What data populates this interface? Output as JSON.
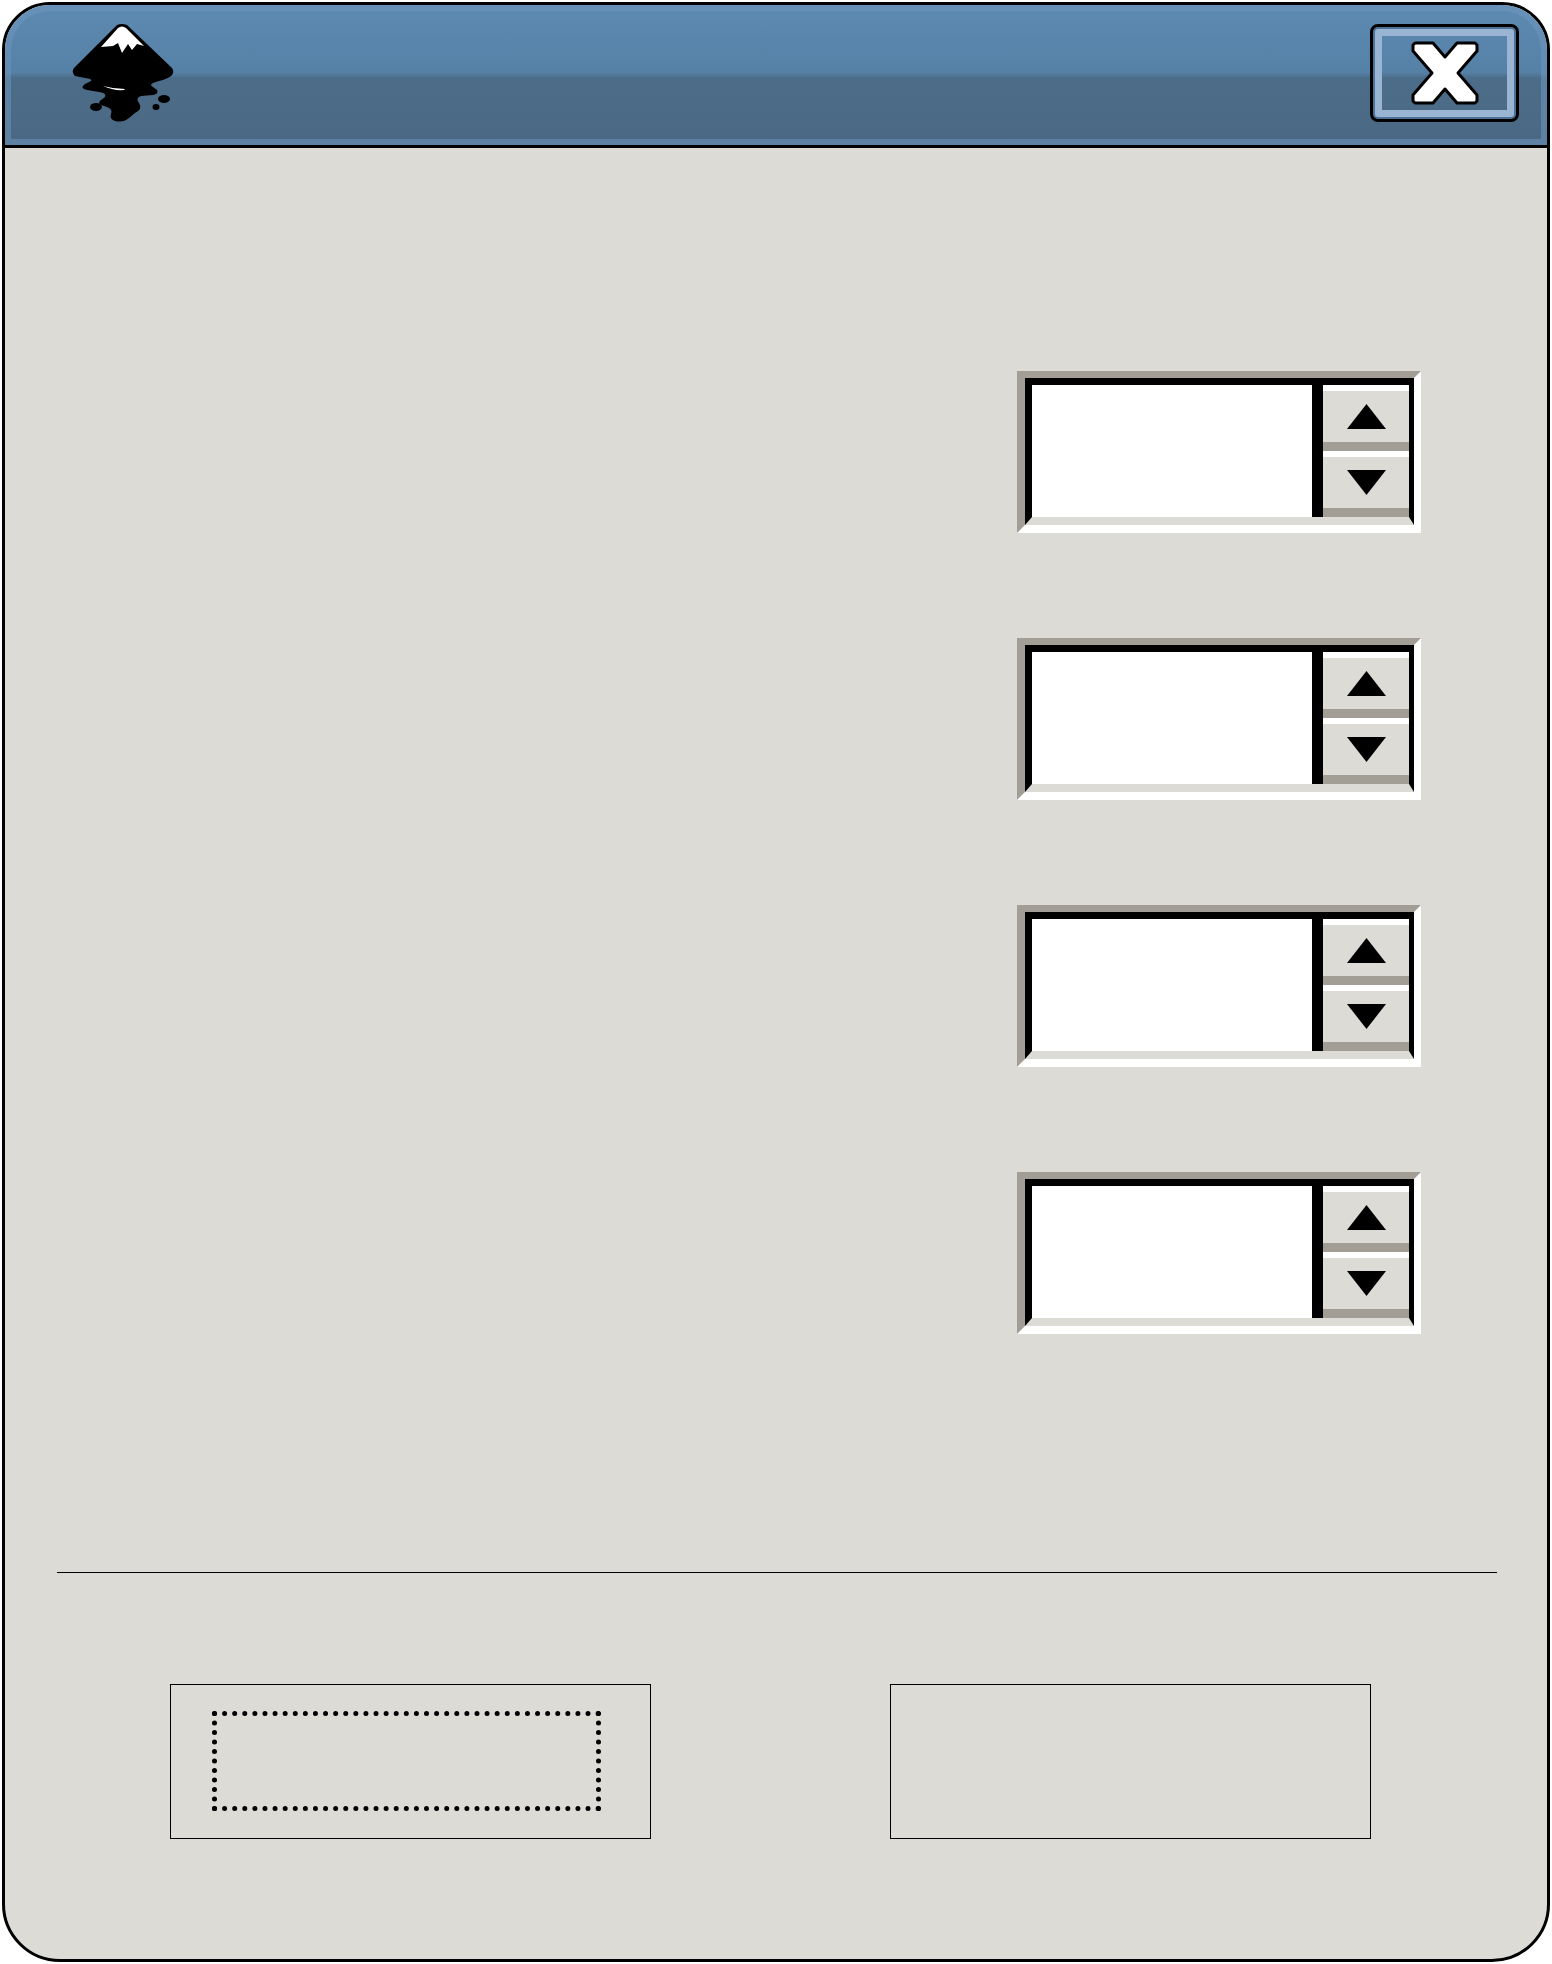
{
  "spin_fields": [
    {
      "kind": "spin"
    },
    {
      "kind": "spin"
    },
    {
      "kind": "spin"
    },
    {
      "kind": "spin"
    }
  ],
  "buttons": [
    {
      "focused": true
    },
    {
      "focused": false
    }
  ]
}
